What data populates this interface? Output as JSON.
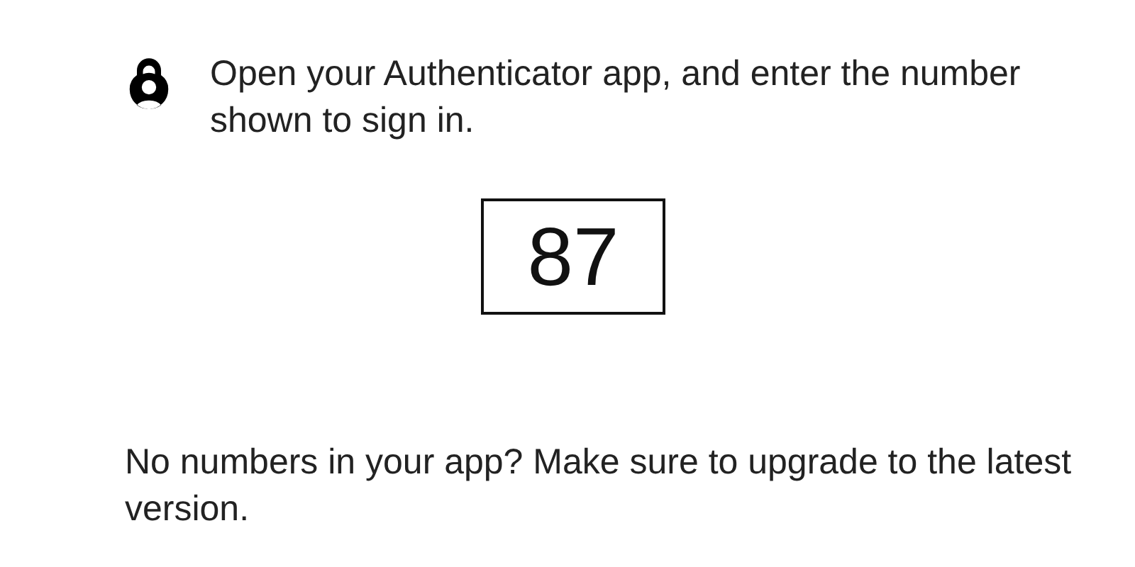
{
  "instruction": "Open your Authenticator app, and enter the number shown to sign in.",
  "number": "87",
  "footer": "No numbers in your app? Make sure to upgrade to the latest version."
}
